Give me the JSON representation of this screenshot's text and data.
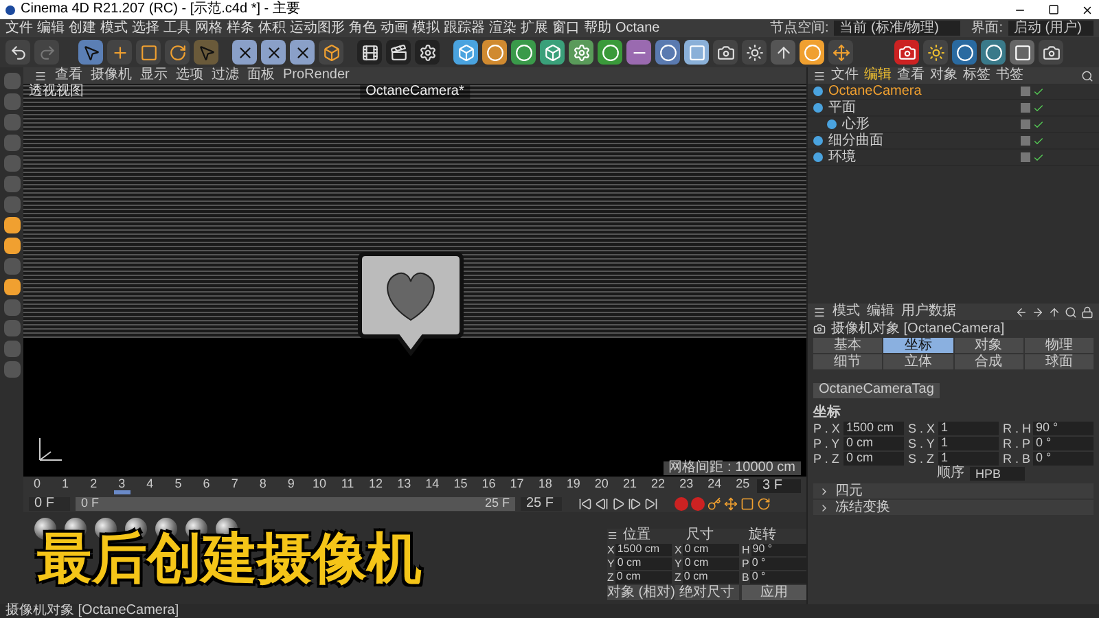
{
  "window": {
    "title": "Cinema 4D R21.207 (RC) - [示范.c4d *] - 主要"
  },
  "menu": [
    "文件",
    "编辑",
    "创建",
    "模式",
    "选择",
    "工具",
    "网格",
    "样条",
    "体积",
    "运动图形",
    "角色",
    "动画",
    "模拟",
    "跟踪器",
    "渲染",
    "扩展",
    "窗口",
    "帮助",
    "Octane"
  ],
  "layout": {
    "node_space_label": "节点空间:",
    "node_space_value": "当前 (标准/物理)",
    "interface_label": "界面:",
    "interface_value": "启动 (用户)"
  },
  "viewport": {
    "menu": [
      "查看",
      "摄像机",
      "显示",
      "选项",
      "过滤",
      "面板",
      "ProRender"
    ],
    "label": "透视视图",
    "camera": "OctaneCamera*",
    "grid_spacing": "网格间距 : 10000 cm"
  },
  "object_manager": {
    "tabs": [
      {
        "label": "文件",
        "selected": false
      },
      {
        "label": "编辑",
        "selected": true
      },
      {
        "label": "查看",
        "selected": false
      },
      {
        "label": "对象",
        "selected": false
      },
      {
        "label": "标签",
        "selected": false
      },
      {
        "label": "书签",
        "selected": false
      }
    ],
    "objects": [
      {
        "name": "OctaneCamera",
        "selected": true
      },
      {
        "name": "平面",
        "selected": false,
        "children": [
          {
            "name": "心形",
            "selected": false
          }
        ]
      },
      {
        "name": "细分曲面",
        "selected": false
      },
      {
        "name": "环境",
        "selected": false
      }
    ]
  },
  "attributes": {
    "menu": [
      "模式",
      "编辑",
      "用户数据"
    ],
    "title": "摄像机对象 [OctaneCamera]",
    "tabs": [
      {
        "label": "基本",
        "selected": false
      },
      {
        "label": "坐标",
        "selected": true
      },
      {
        "label": "对象",
        "selected": false
      },
      {
        "label": "物理",
        "selected": false
      },
      {
        "label": "细节",
        "selected": false
      },
      {
        "label": "立体",
        "selected": false
      },
      {
        "label": "合成",
        "selected": false
      },
      {
        "label": "球面",
        "selected": false
      }
    ],
    "tag_tab": "OctaneCameraTag",
    "section": "坐标",
    "fields": [
      [
        {
          "label": "P . X",
          "value": "1500 cm"
        },
        {
          "label": "S . X",
          "value": "1"
        },
        {
          "label": "R . H",
          "value": "90 °"
        }
      ],
      [
        {
          "label": "P . Y",
          "value": "0 cm"
        },
        {
          "label": "S . Y",
          "value": "1"
        },
        {
          "label": "R . P",
          "value": "0 °"
        }
      ],
      [
        {
          "label": "P . Z",
          "value": "0 cm"
        },
        {
          "label": "S . Z",
          "value": "1"
        },
        {
          "label": "R . B",
          "value": "0 °"
        }
      ]
    ],
    "order_label": "顺序",
    "order_value": "HPB",
    "groups": [
      {
        "label": "四元",
        "expanded": false
      },
      {
        "label": "冻结变换",
        "expanded": false
      }
    ]
  },
  "timeline": {
    "ticks": [
      "0",
      "1",
      "2",
      "3",
      "4",
      "5",
      "6",
      "7",
      "8",
      "9",
      "10",
      "11",
      "12",
      "13",
      "14",
      "15",
      "16",
      "17",
      "18",
      "19",
      "20",
      "21",
      "22",
      "23",
      "24",
      "25"
    ],
    "level": 0.12,
    "current": "3 F",
    "start": "0 F",
    "range": {
      "start": "0 F",
      "end": "25 F",
      "level": 1
    },
    "end": "25 F"
  },
  "caption": "最后创建摄像机",
  "coordinates": {
    "headers": [
      "位置",
      "尺寸",
      "旋转"
    ],
    "rows": [
      [
        {
          "axis": "X",
          "value": "1500 cm"
        },
        {
          "axis": "X",
          "value": "0 cm"
        },
        {
          "axis": "H",
          "value": "90 °"
        }
      ],
      [
        {
          "axis": "Y",
          "value": "0 cm"
        },
        {
          "axis": "Y",
          "value": "0 cm"
        },
        {
          "axis": "P",
          "value": "0 °"
        }
      ],
      [
        {
          "axis": "Z",
          "value": "0 cm"
        },
        {
          "axis": "Z",
          "value": "0 cm"
        },
        {
          "axis": "B",
          "value": "0 °"
        }
      ]
    ],
    "mode": "对象 (相对)",
    "size_mode": "绝对尺寸",
    "apply": "应用"
  },
  "status_bar": "摄像机对象 [OctaneCamera]"
}
